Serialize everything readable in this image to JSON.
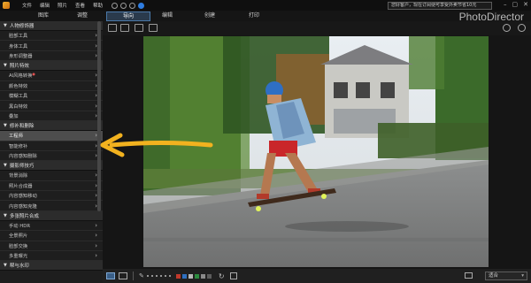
{
  "titlebar": {
    "menu": [
      "文件",
      "编辑",
      "照片",
      "查看",
      "帮助"
    ],
    "notification": "您好客户，现在订阅便可享受外卖节省10元",
    "window_controls": [
      "–",
      "▢",
      "✕"
    ],
    "brand": "PhotoDirector"
  },
  "modules": {
    "library": "图库",
    "adjust": "调整",
    "guided": "导向",
    "edit": "编辑",
    "create": "创建",
    "print": "打印"
  },
  "panel": {
    "groups": [
      {
        "title": "人物修饰器",
        "items": [
          "脸部工具",
          "身体工具",
          "身形调整器"
        ]
      },
      {
        "title": "照片特效",
        "items": [
          "AI风格转换",
          "颜色特效",
          "模糊工具",
          "黑白特效",
          "叠加"
        ]
      },
      {
        "title": "修补和删除",
        "items": [
          "工程师",
          "智能修补",
          "内容感知删除"
        ]
      },
      {
        "title": "摄影师技巧",
        "items": [
          "背景消除",
          "照片合成器",
          "内容感知移动",
          "内容感知克隆"
        ]
      },
      {
        "title": "多张照片合成",
        "items": [
          "手动 HDR",
          "全景照片",
          "脸部交换",
          "多重曝光"
        ]
      },
      {
        "title": "帮与水印",
        "items": []
      }
    ],
    "selected_item": "工程师",
    "badge_item": "AI风格转换"
  },
  "bottombar": {
    "fit_label": "适合",
    "swatch_colors": [
      "#c0392b",
      "#2e6fbf",
      "#b7b7b7",
      "#2b8a3e",
      "#8a8a8a",
      "#5c5c5c"
    ]
  },
  "colors": {
    "accent": "#4a78a8",
    "arrow": "#f2b21f"
  },
  "icons": {
    "toolbar_left": [
      "compare-icon",
      "split-view-icon",
      "before-after-icon",
      "history-icon"
    ],
    "toolbar_right": [
      "hand-tool-icon",
      "zoom-out-icon"
    ]
  }
}
